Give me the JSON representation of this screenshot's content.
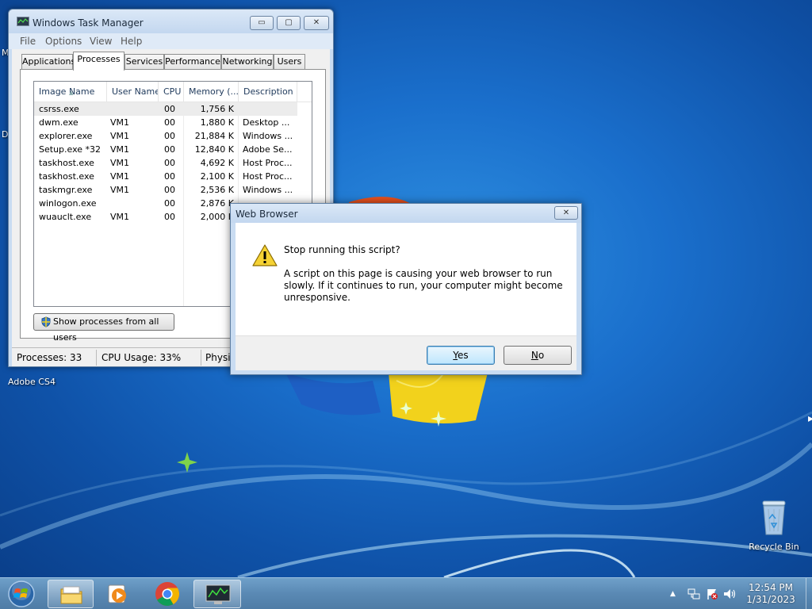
{
  "desktop": {
    "edge_letters": [
      "M",
      "D"
    ],
    "shortcut_label": "Adobe CS4",
    "recycle_bin_label": "Recycle Bin"
  },
  "taskmgr": {
    "title": "Windows Task Manager",
    "caption_buttons": {
      "minimize": "▭",
      "maximize": "▢",
      "close": "✕"
    },
    "menu": [
      "File",
      "Options",
      "View",
      "Help"
    ],
    "tabs": [
      "Applications",
      "Processes",
      "Services",
      "Performance",
      "Networking",
      "Users"
    ],
    "active_tab": "Processes",
    "columns": [
      "Image Name",
      "User Name",
      "CPU",
      "Memory (...",
      "Description"
    ],
    "rows": [
      {
        "name": "csrss.exe",
        "user": "",
        "cpu": "00",
        "memory": "1,756 K",
        "desc": ""
      },
      {
        "name": "dwm.exe",
        "user": "VM1",
        "cpu": "00",
        "memory": "1,880 K",
        "desc": "Desktop ..."
      },
      {
        "name": "explorer.exe",
        "user": "VM1",
        "cpu": "00",
        "memory": "21,884 K",
        "desc": "Windows ..."
      },
      {
        "name": "Setup.exe *32",
        "user": "VM1",
        "cpu": "00",
        "memory": "12,840 K",
        "desc": "Adobe Se..."
      },
      {
        "name": "taskhost.exe",
        "user": "VM1",
        "cpu": "00",
        "memory": "4,692 K",
        "desc": "Host Proc..."
      },
      {
        "name": "taskhost.exe",
        "user": "VM1",
        "cpu": "00",
        "memory": "2,100 K",
        "desc": "Host Proc..."
      },
      {
        "name": "taskmgr.exe",
        "user": "VM1",
        "cpu": "00",
        "memory": "2,536 K",
        "desc": "Windows ..."
      },
      {
        "name": "winlogon.exe",
        "user": "",
        "cpu": "00",
        "memory": "2,876 K",
        "desc": ""
      },
      {
        "name": "wuauclt.exe",
        "user": "VM1",
        "cpu": "00",
        "memory": "2,000 K",
        "desc": ""
      }
    ],
    "show_all_button": "Show processes from all users",
    "status": {
      "processes": "Processes: 33",
      "cpu": "CPU Usage: 33%",
      "physical": "Physic"
    }
  },
  "dialog": {
    "title": "Web Browser",
    "close_glyph": "✕",
    "heading": "Stop running this script?",
    "message": "A script on this page is causing your web browser to run slowly. If it continues to run, your computer might become unresponsive.",
    "yes_mnemonic": "Y",
    "yes_rest": "es",
    "no_mnemonic": "N",
    "no_rest": "o"
  },
  "taskbar": {
    "time": "12:54 PM",
    "date": "1/31/2023",
    "tray_arrow": "▲"
  }
}
